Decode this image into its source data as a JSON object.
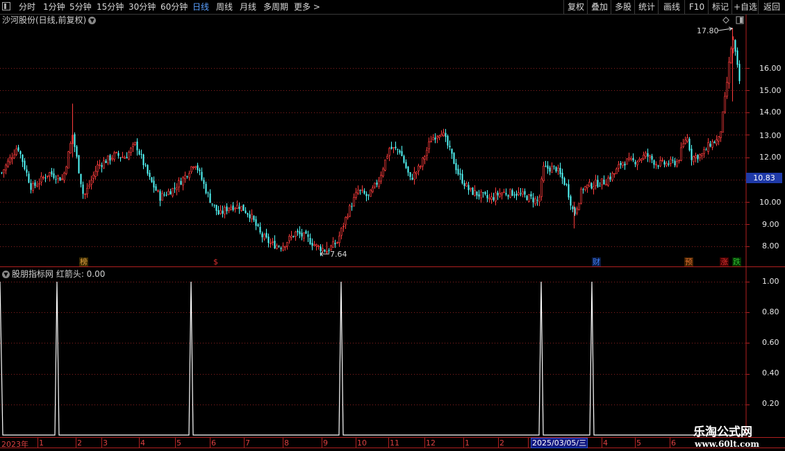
{
  "toolbar": {
    "periods": [
      "分时",
      "1分钟",
      "5分钟",
      "15分钟",
      "30分钟",
      "60分钟",
      "日线",
      "周线",
      "月线",
      "多周期",
      "更多 >"
    ],
    "active_index": 6,
    "right_buttons": [
      "复权",
      "叠加",
      "多股",
      "统计",
      "画线",
      "F10",
      "标记",
      "+自选",
      "返回"
    ]
  },
  "main_chart": {
    "caption": "沙河股份(日线,前复权)",
    "y_ticks": [
      "16.00",
      "15.00",
      "14.00",
      "13.00",
      "12.00",
      "11.00",
      "10.00",
      "9.00",
      "8.00"
    ],
    "current_price": "10.83",
    "high_label": "17.80",
    "low_label": "7.64",
    "badges": [
      {
        "text": "榜",
        "color": "#e0a040"
      },
      {
        "text": "$",
        "color": "#e03030"
      },
      {
        "text": "财",
        "color": "#4080ff"
      },
      {
        "text": "预",
        "color": "#e07030"
      },
      {
        "text": "涨",
        "color": "#e03030"
      },
      {
        "text": "跌",
        "color": "#30c030"
      }
    ]
  },
  "indicator": {
    "caption": "股朋指标网  红箭头: 0.00",
    "y_ticks": [
      "1.00",
      "0.80",
      "0.60",
      "0.40",
      "0.20"
    ],
    "signal_count": 7
  },
  "date_axis": {
    "labels": [
      "2023年",
      "1",
      "2",
      "3",
      "4",
      "5",
      "6",
      "7",
      "8",
      "9",
      "10",
      "11",
      "12",
      "1",
      "2",
      "4",
      "5",
      "6",
      "7"
    ],
    "cursor_date": "2025/03/05/三"
  },
  "watermark": {
    "line1": "乐淘公式网",
    "line2": "www.60lt.com"
  },
  "colors": {
    "up": "#ff3c3c",
    "down": "#54ffff",
    "grid": "#8a1f1f",
    "indicator": "#ffffff",
    "axis": "#b02020"
  }
}
